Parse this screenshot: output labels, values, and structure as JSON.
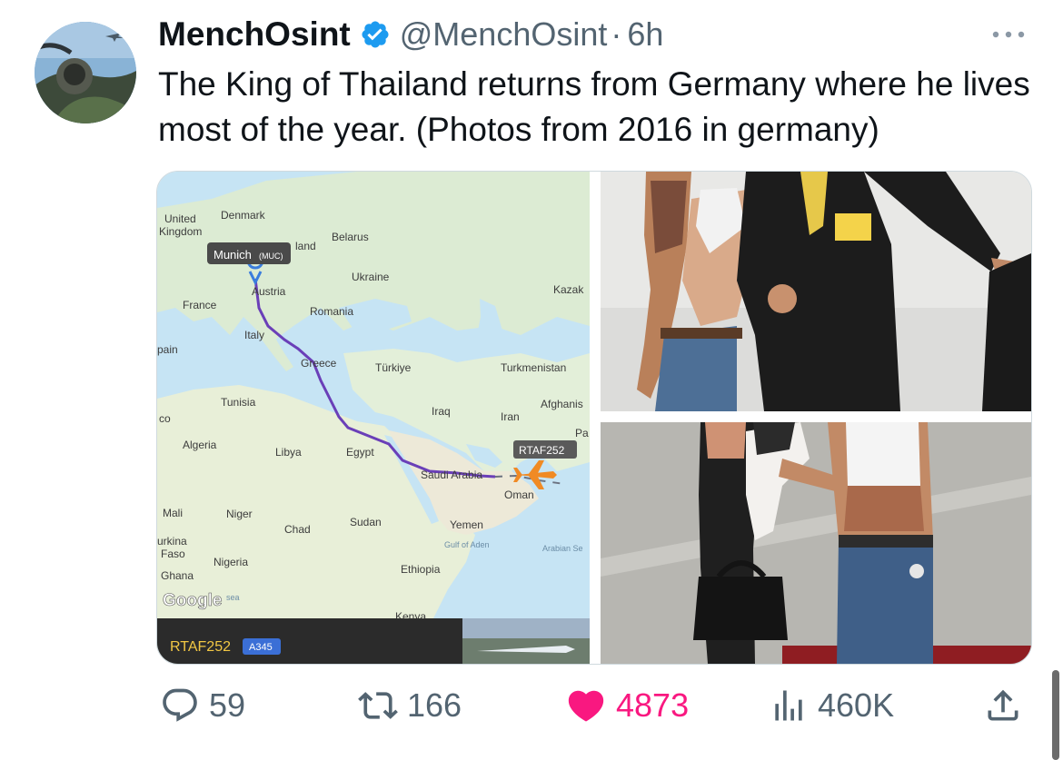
{
  "author": {
    "name": "MenchOsint",
    "handle": "@MenchOsint",
    "separator": "·",
    "time": "6h"
  },
  "tweet_text": "The King of Thailand returns from Germany where he lives most of the year. (Photos from 2016 in germany)",
  "map": {
    "labels": {
      "united_kingdom_1": "United",
      "united_kingdom_2": "Kingdom",
      "denmark": "Denmark",
      "belarus": "Belarus",
      "poland": "land",
      "ukraine": "Ukraine",
      "austria": "Austria",
      "france": "France",
      "romania": "Romania",
      "kazakhstan": "Kazak",
      "italy": "Italy",
      "spain": "pain",
      "greece": "Greece",
      "turkiye": "Türkiye",
      "turkmenistan": "Turkmenistan",
      "tunisia": "Tunisia",
      "afghanistan": "Afghanis",
      "iraq": "Iraq",
      "iran": "Iran",
      "morocco": "co",
      "pakistan": "Pa",
      "algeria": "Algeria",
      "libya": "Libya",
      "egypt": "Egypt",
      "saudi_arabia": "Saudi Arabia",
      "oman": "Oman",
      "mali": "Mali",
      "niger": "Niger",
      "chad": "Chad",
      "sudan": "Sudan",
      "yemen": "Yemen",
      "burkina_1": "urkina",
      "burkina_2": "Faso",
      "gulf_of_aden": "Gulf of Aden",
      "arabian_sea": "Arabian Se",
      "nigeria": "Nigeria",
      "ghana": "Ghana",
      "ethiopia": "Ethiopia",
      "kenya": "Kenya",
      "sea": "sea"
    },
    "origin_label": "Munich",
    "origin_code": "(MUC)",
    "flight_label": "RTAF252",
    "google_logo": "Google",
    "flight_bar_callsign": "RTAF252",
    "flight_bar_aircraft": "A345",
    "colors": {
      "route": "#6a3fb8",
      "water": "#c6e4f4",
      "land": "#dcebd3"
    }
  },
  "actions": {
    "replies": "59",
    "reposts": "166",
    "likes": "4873",
    "views": "460K"
  },
  "colors": {
    "accent": "#1d9bf0",
    "like": "#f91880",
    "muted": "#536471"
  }
}
